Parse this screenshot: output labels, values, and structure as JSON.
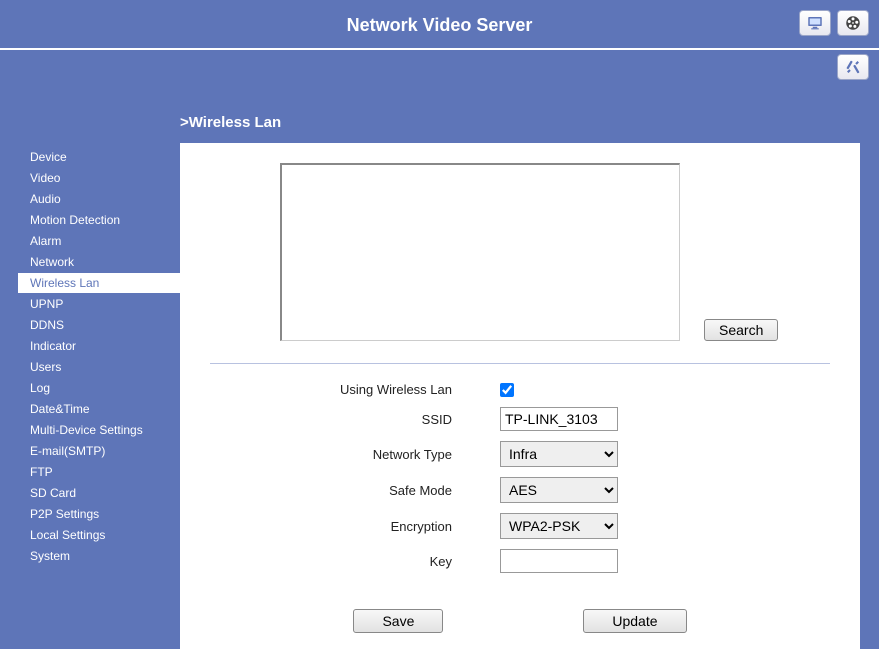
{
  "header": {
    "title": "Network Video Server"
  },
  "page": {
    "title": ">Wireless Lan"
  },
  "sidebar": {
    "items": [
      {
        "label": "Device",
        "active": false
      },
      {
        "label": "Video",
        "active": false
      },
      {
        "label": "Audio",
        "active": false
      },
      {
        "label": "Motion Detection",
        "active": false
      },
      {
        "label": "Alarm",
        "active": false
      },
      {
        "label": "Network",
        "active": false
      },
      {
        "label": "Wireless Lan",
        "active": true
      },
      {
        "label": "UPNP",
        "active": false
      },
      {
        "label": "DDNS",
        "active": false
      },
      {
        "label": "Indicator",
        "active": false
      },
      {
        "label": "Users",
        "active": false
      },
      {
        "label": "Log",
        "active": false
      },
      {
        "label": "Date&Time",
        "active": false
      },
      {
        "label": "Multi-Device Settings",
        "active": false
      },
      {
        "label": "E-mail(SMTP)",
        "active": false
      },
      {
        "label": "FTP",
        "active": false
      },
      {
        "label": "SD Card",
        "active": false
      },
      {
        "label": "P2P Settings",
        "active": false
      },
      {
        "label": "Local Settings",
        "active": false
      },
      {
        "label": "System",
        "active": false
      }
    ]
  },
  "buttons": {
    "search": "Search",
    "save": "Save",
    "update": "Update"
  },
  "form": {
    "using_wireless_label": "Using Wireless Lan",
    "using_wireless_checked": true,
    "ssid_label": "SSID",
    "ssid_value": "TP-LINK_3103",
    "network_type_label": "Network Type",
    "network_type_value": "Infra",
    "safe_mode_label": "Safe Mode",
    "safe_mode_value": "AES",
    "encryption_label": "Encryption",
    "encryption_value": "WPA2-PSK",
    "key_label": "Key",
    "key_value": ""
  }
}
